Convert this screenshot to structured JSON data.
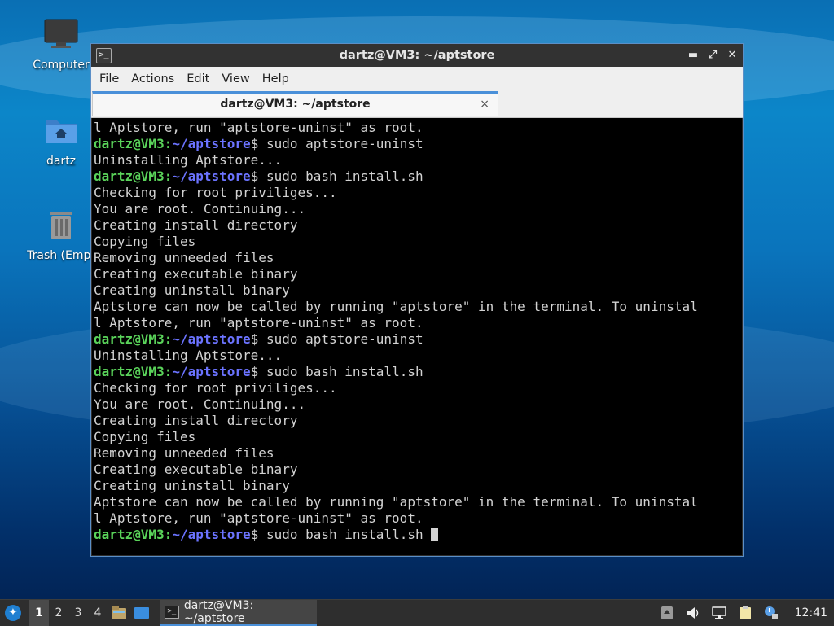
{
  "desktop": {
    "icons": [
      {
        "label": "Computer"
      },
      {
        "label": "dartz"
      },
      {
        "label": "Trash (Empt"
      }
    ]
  },
  "window": {
    "title": "dartz@VM3: ~/aptstore",
    "menu": [
      "File",
      "Actions",
      "Edit",
      "View",
      "Help"
    ],
    "tab_label": "dartz@VM3: ~/aptstore",
    "tab_close": "×",
    "controls": {
      "minimize": "▬",
      "maximize": "⤢",
      "close": "✕"
    }
  },
  "terminal": {
    "user_host": "dartz@VM3",
    "path": "~/aptstore",
    "lines": [
      {
        "type": "out",
        "text": "l Aptstore, run \"aptstore-uninst\" as root."
      },
      {
        "type": "cmd",
        "text": "sudo aptstore-uninst"
      },
      {
        "type": "out",
        "text": "Uninstalling Aptstore..."
      },
      {
        "type": "cmd",
        "text": "sudo bash install.sh"
      },
      {
        "type": "out",
        "text": "Checking for root priviliges..."
      },
      {
        "type": "out",
        "text": "You are root. Continuing..."
      },
      {
        "type": "out",
        "text": "Creating install directory"
      },
      {
        "type": "out",
        "text": "Copying files"
      },
      {
        "type": "out",
        "text": "Removing unneeded files"
      },
      {
        "type": "out",
        "text": "Creating executable binary"
      },
      {
        "type": "out",
        "text": "Creating uninstall binary"
      },
      {
        "type": "out",
        "text": "Aptstore can now be called by running \"aptstore\" in the terminal. To uninstal"
      },
      {
        "type": "out",
        "text": "l Aptstore, run \"aptstore-uninst\" as root."
      },
      {
        "type": "cmd",
        "text": "sudo aptstore-uninst"
      },
      {
        "type": "out",
        "text": "Uninstalling Aptstore..."
      },
      {
        "type": "cmd",
        "text": "sudo bash install.sh"
      },
      {
        "type": "out",
        "text": "Checking for root priviliges..."
      },
      {
        "type": "out",
        "text": "You are root. Continuing..."
      },
      {
        "type": "out",
        "text": "Creating install directory"
      },
      {
        "type": "out",
        "text": "Copying files"
      },
      {
        "type": "out",
        "text": "Removing unneeded files"
      },
      {
        "type": "out",
        "text": "Creating executable binary"
      },
      {
        "type": "out",
        "text": "Creating uninstall binary"
      },
      {
        "type": "out",
        "text": "Aptstore can now be called by running \"aptstore\" in the terminal. To uninstal"
      },
      {
        "type": "out",
        "text": "l Aptstore, run \"aptstore-uninst\" as root."
      },
      {
        "type": "cmd",
        "text": "sudo bash install.sh ",
        "cursor": true
      }
    ]
  },
  "taskbar": {
    "workspaces": [
      "1",
      "2",
      "3",
      "4"
    ],
    "active_workspace": "1",
    "task_label": "dartz@VM3: ~/aptstore",
    "clock": "12:41"
  },
  "colors": {
    "prompt_user": "#5ad35a",
    "prompt_path": "#6b73ff",
    "accent": "#4a90d9"
  }
}
